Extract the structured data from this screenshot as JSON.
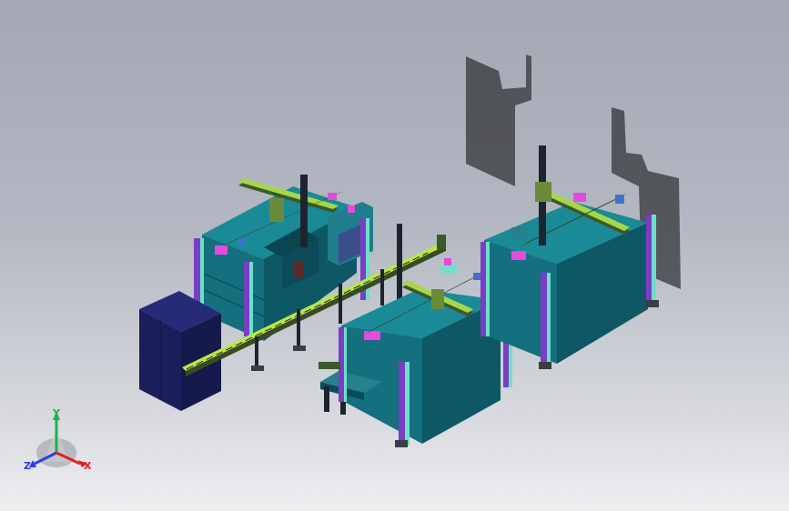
{
  "view": {
    "background_top": "#a3a7b3",
    "background_bottom": "#eeeff1"
  },
  "model": {
    "components": [
      "electrical-cabinet",
      "machine-left",
      "machine-middle",
      "machine-right",
      "gantry-left",
      "gantry-middle",
      "gantry-right",
      "conveyor-rail",
      "shadow-projection"
    ],
    "colors": {
      "machine_body": "#14707e",
      "machine_body_dark": "#0e5764",
      "cabinet": "#1a1f5c",
      "gantry_rail": "#3a5a2a",
      "gantry_highlight": "#a7d64c",
      "frame_purple": "#7a3ec6",
      "frame_teal": "#6fe0c8",
      "accent_magenta": "#e64adf",
      "shadow": "#2f3134"
    }
  },
  "triad": {
    "y_label": "Y",
    "z_label": "Z",
    "x_label": "X",
    "y_color": "#22b14c",
    "z_color": "#2b3fe0",
    "x_color": "#e02020"
  }
}
